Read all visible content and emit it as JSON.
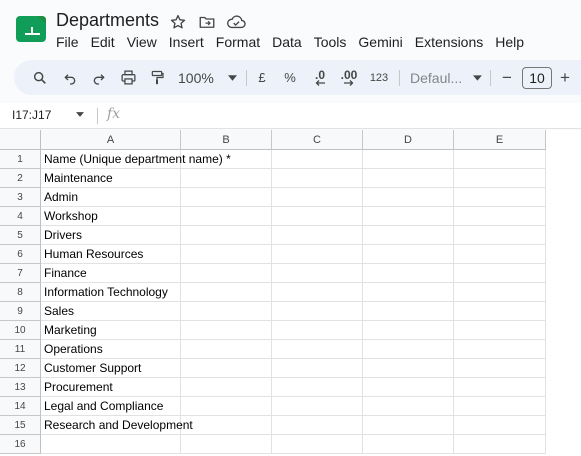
{
  "document": {
    "title": "Departments"
  },
  "menu": [
    "File",
    "Edit",
    "View",
    "Insert",
    "Format",
    "Data",
    "Tools",
    "Gemini",
    "Extensions",
    "Help"
  ],
  "toolbar": {
    "zoom": "100%",
    "currency": "£",
    "percent": "%",
    "decrease_decimal": ".0",
    "increase_decimal": ".00",
    "number_format": "123",
    "font": "Defaul...",
    "font_size": "10",
    "minus": "−",
    "plus": "+"
  },
  "formula_bar": {
    "name_box": "I17:J17",
    "fx": "fx"
  },
  "columns": [
    "A",
    "B",
    "C",
    "D",
    "E"
  ],
  "rows": [
    "1",
    "2",
    "3",
    "4",
    "5",
    "6",
    "7",
    "8",
    "9",
    "10",
    "11",
    "12",
    "13",
    "14",
    "15",
    "16"
  ],
  "cells_a": [
    "Name (Unique department name) *",
    "Maintenance",
    "Admin",
    "Workshop",
    "Drivers",
    "Human Resources",
    "Finance",
    "Information Technology",
    "Sales",
    "Marketing",
    "Operations",
    "Customer Support",
    "Procurement",
    "Legal and Compliance",
    "Research and Development",
    ""
  ],
  "colors": {
    "logo_green": "#0f9d58",
    "toolbar_bg": "#edf2fa"
  }
}
